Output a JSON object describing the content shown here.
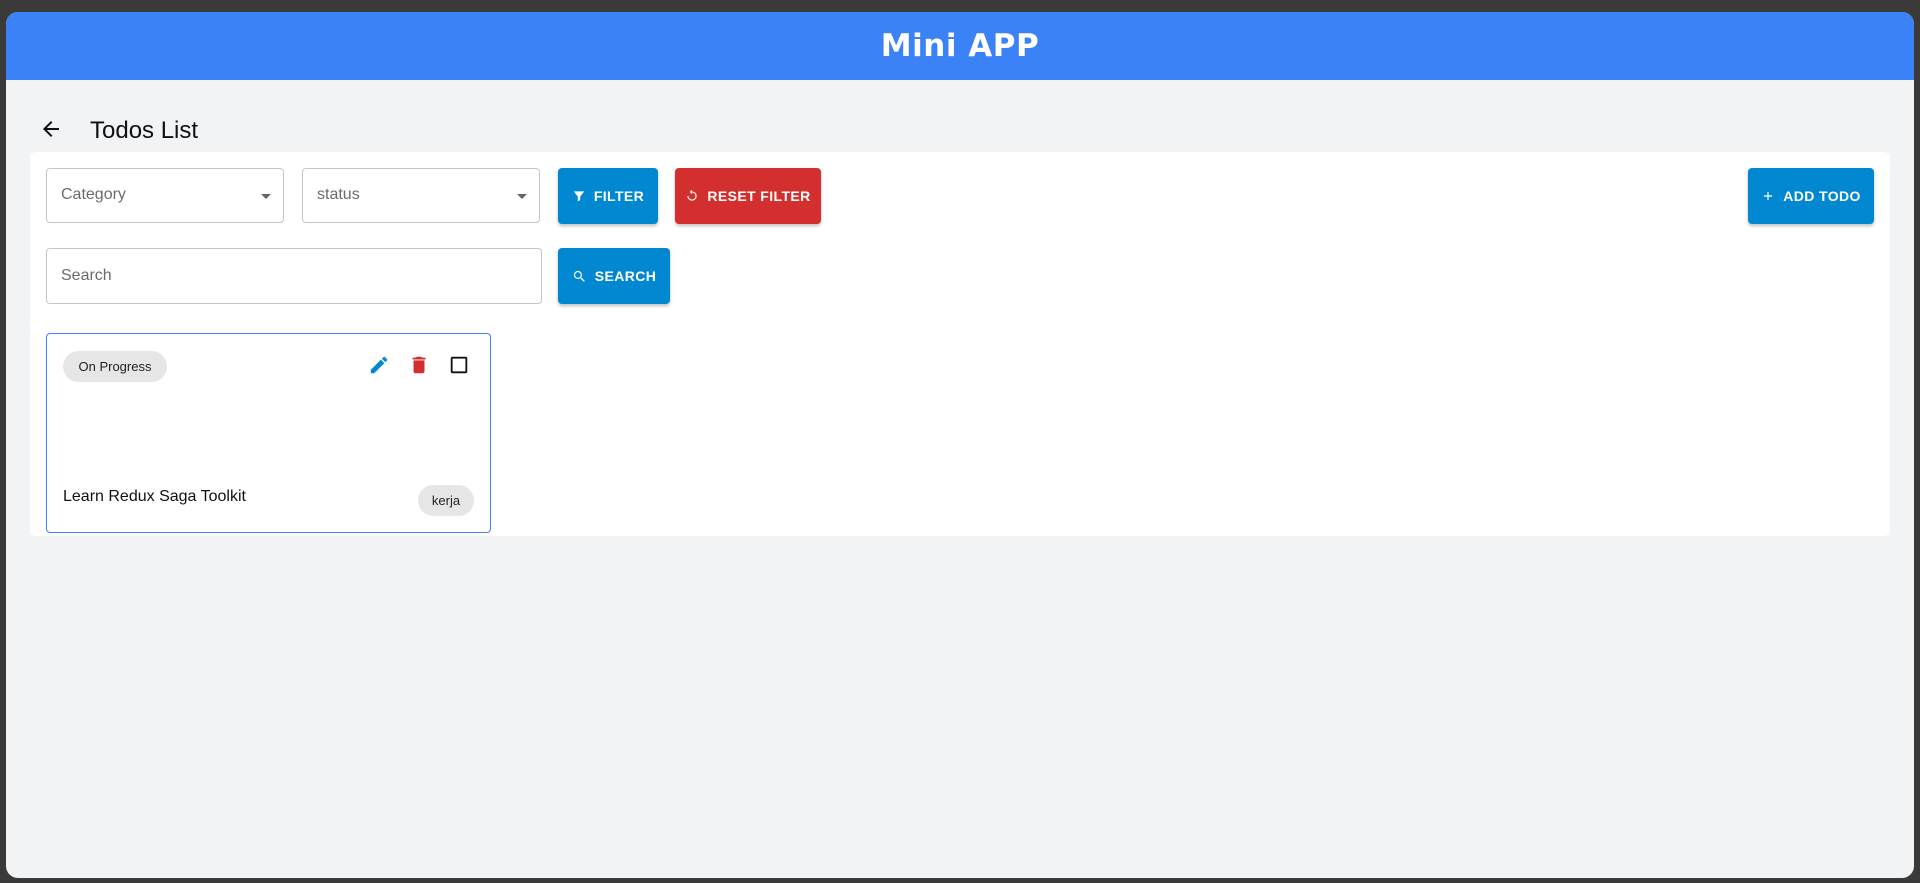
{
  "app": {
    "title": "Mini APP"
  },
  "page": {
    "title": "Todos List"
  },
  "filters": {
    "category_label": "Category",
    "status_label": "status",
    "filter_button": "FILTER",
    "reset_button": "RESET FILTER",
    "add_button": "ADD TODO"
  },
  "search": {
    "placeholder": "Search",
    "value": "",
    "button": "SEARCH"
  },
  "todos": [
    {
      "status": "On Progress",
      "title": "Learn Redux Saga Toolkit",
      "category": "kerja",
      "completed": false
    }
  ],
  "colors": {
    "appbar": "#3b82f6",
    "primary_button": "#0288d1",
    "danger_button": "#d32f2f",
    "edit_icon": "#0288d1",
    "delete_icon": "#d32f2f",
    "card_border": "#3b82f6",
    "page_background": "#f2f3f5"
  },
  "icons": {
    "back": "arrow-back-icon",
    "filter": "filter-icon",
    "reset": "refresh-icon",
    "add": "plus-icon",
    "search": "search-icon",
    "edit": "pencil-icon",
    "delete": "trash-icon",
    "checkbox": "checkbox-icon"
  }
}
